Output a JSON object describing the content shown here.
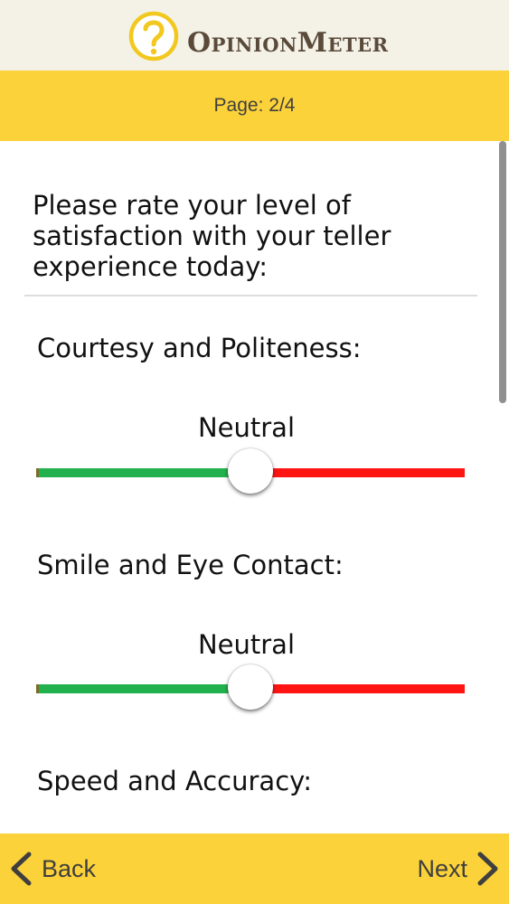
{
  "header": {
    "brand_initial_o": "O",
    "brand_rest_1": "PINION",
    "brand_initial_m": "M",
    "brand_rest_2": "ETER",
    "logo_icon": "question-mark-circle-icon"
  },
  "page_indicator": "Page: 2/4",
  "question": "Please rate your level of satisfaction with your teller experience today:",
  "items": [
    {
      "label": "Courtesy and Politeness:",
      "value_label": "Neutral",
      "value": 0.5
    },
    {
      "label": "Smile and Eye Contact:",
      "value_label": "Neutral",
      "value": 0.5
    },
    {
      "label": "Speed and Accuracy:"
    }
  ],
  "slider_colors": {
    "positive": "#23b14d",
    "negative": "#ff1414"
  },
  "footer": {
    "back_label": "Back",
    "next_label": "Next",
    "back_icon": "chevron-left-icon",
    "next_icon": "chevron-right-icon"
  },
  "colors": {
    "accent": "#fcd23a",
    "header_bg": "#f4f1e7",
    "brand_text": "#5a4a3a"
  }
}
